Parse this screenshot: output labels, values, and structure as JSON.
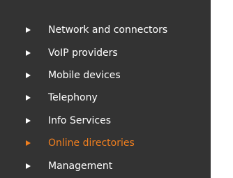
{
  "colors": {
    "panel_background": "#333333",
    "text": "#ffffff",
    "active": "#f07f1f"
  },
  "menu": {
    "items": [
      {
        "label": "Network and connectors",
        "icon": "triangle-right-icon",
        "active": false
      },
      {
        "label": "VoIP providers",
        "icon": "triangle-right-icon",
        "active": false
      },
      {
        "label": "Mobile devices",
        "icon": "triangle-right-icon",
        "active": false
      },
      {
        "label": "Telephony",
        "icon": "triangle-right-icon",
        "active": false
      },
      {
        "label": "Info Services",
        "icon": "triangle-right-icon",
        "active": false
      },
      {
        "label": "Online directories",
        "icon": "triangle-right-icon",
        "active": true
      },
      {
        "label": "Management",
        "icon": "triangle-right-icon",
        "active": false
      }
    ]
  }
}
